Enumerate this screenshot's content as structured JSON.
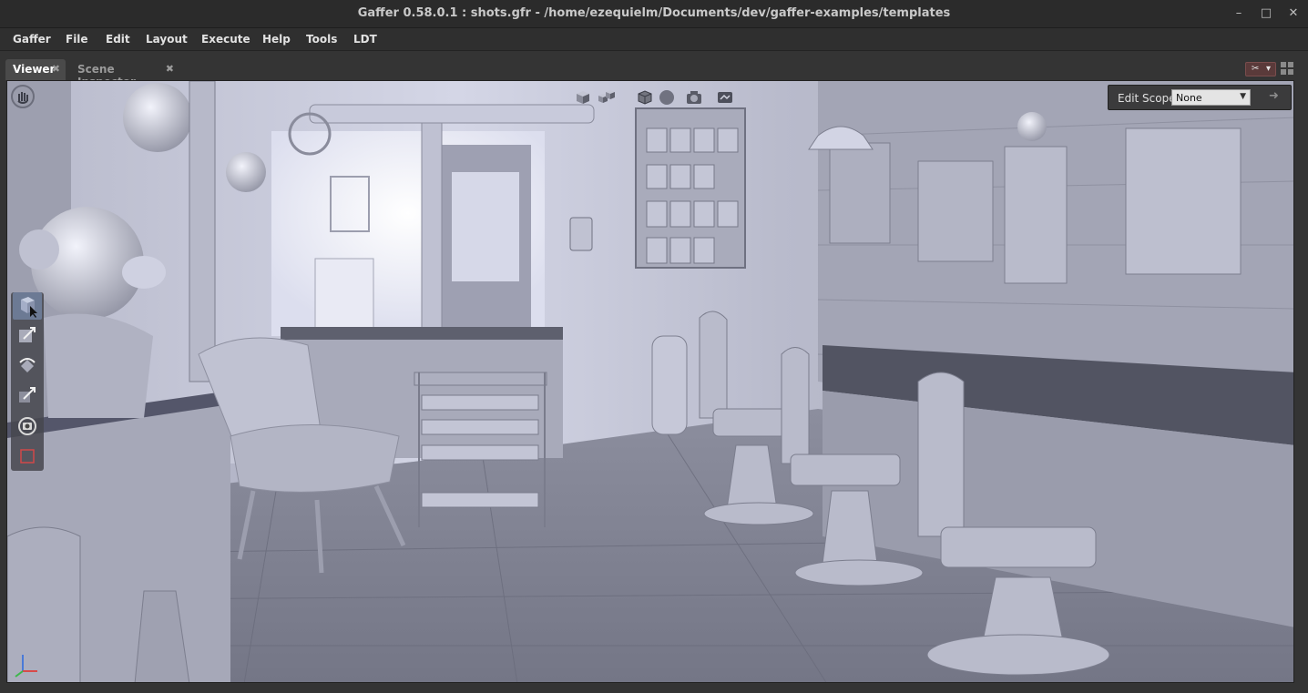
{
  "window": {
    "title": "Gaffer 0.58.0.1 : shots.gfr - /home/ezequielm/Documents/dev/gaffer-examples/templates",
    "controls": {
      "minimize": "–",
      "maximize": "□",
      "close": "✕"
    }
  },
  "menubar": {
    "items": [
      {
        "label": "Gaffer"
      },
      {
        "label": "File"
      },
      {
        "label": "Edit"
      },
      {
        "label": "Layout"
      },
      {
        "label": "Execute"
      },
      {
        "label": "Help"
      },
      {
        "label": "Tools"
      },
      {
        "label": "LDT"
      }
    ]
  },
  "tabs": [
    {
      "label": "Viewer",
      "close": "✖",
      "active": true
    },
    {
      "label": "Scene Inspector",
      "close": "✖",
      "active": false
    }
  ],
  "layout_button": {
    "left": "✂",
    "right": "▾"
  },
  "viewer": {
    "edit_scope": {
      "label": "Edit Scope",
      "value": "None",
      "caret": "▼",
      "arrow": "➜"
    },
    "tools": [
      {
        "icon": "select-icon",
        "active": true
      },
      {
        "icon": "translate-icon",
        "active": false
      },
      {
        "icon": "rotate-icon",
        "active": false
      },
      {
        "icon": "scale-icon",
        "active": false
      },
      {
        "icon": "camera-tool-icon",
        "active": false
      },
      {
        "icon": "crop-window-icon",
        "active": false
      }
    ],
    "toolbar_icons": [
      "expand-selection-icon",
      "fully-expand-icon",
      "wireframe-icon",
      "shading-icon",
      "camera-icon",
      "lighting-icon"
    ],
    "colors": {
      "viewport_background": "#b4b6c8",
      "active_tool": "#6c7a94",
      "layout_button": "#5a3a3a"
    }
  }
}
